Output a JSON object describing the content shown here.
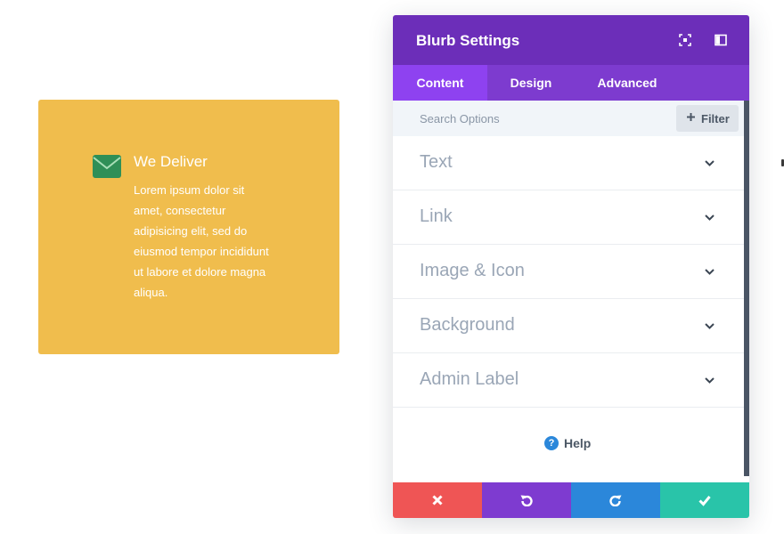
{
  "colors": {
    "blurb_background": "#f0bd4d",
    "envelope_icon": "#2f8f57",
    "header": "#6c2eb9",
    "tabs_bar": "#7d3bcf",
    "active_tab": "#8e42f0",
    "discard": "#ef5555",
    "undo": "#7e3bd0",
    "redo": "#2b87da",
    "save": "#29c4a9"
  },
  "blurb": {
    "icon": "envelope-icon",
    "title": "We Deliver",
    "body": "Lorem ipsum dolor sit amet, consectetur adipisicing elit, sed do eiusmod tempor incididunt ut labore et dolore magna aliqua."
  },
  "panel": {
    "title": "Blurb Settings",
    "header_icons": [
      "expand-icon",
      "sidebar-toggle-icon"
    ],
    "tabs": [
      {
        "label": "Content",
        "active": true
      },
      {
        "label": "Design",
        "active": false
      },
      {
        "label": "Advanced",
        "active": false
      }
    ],
    "search": {
      "placeholder": "Search Options",
      "value": ""
    },
    "filter_label": "Filter",
    "sections": [
      {
        "label": "Text"
      },
      {
        "label": "Link"
      },
      {
        "label": "Image & Icon"
      },
      {
        "label": "Background"
      },
      {
        "label": "Admin Label"
      }
    ],
    "help_label": "Help",
    "actions": [
      "discard-icon",
      "undo-icon",
      "redo-icon",
      "save-check-icon"
    ]
  }
}
